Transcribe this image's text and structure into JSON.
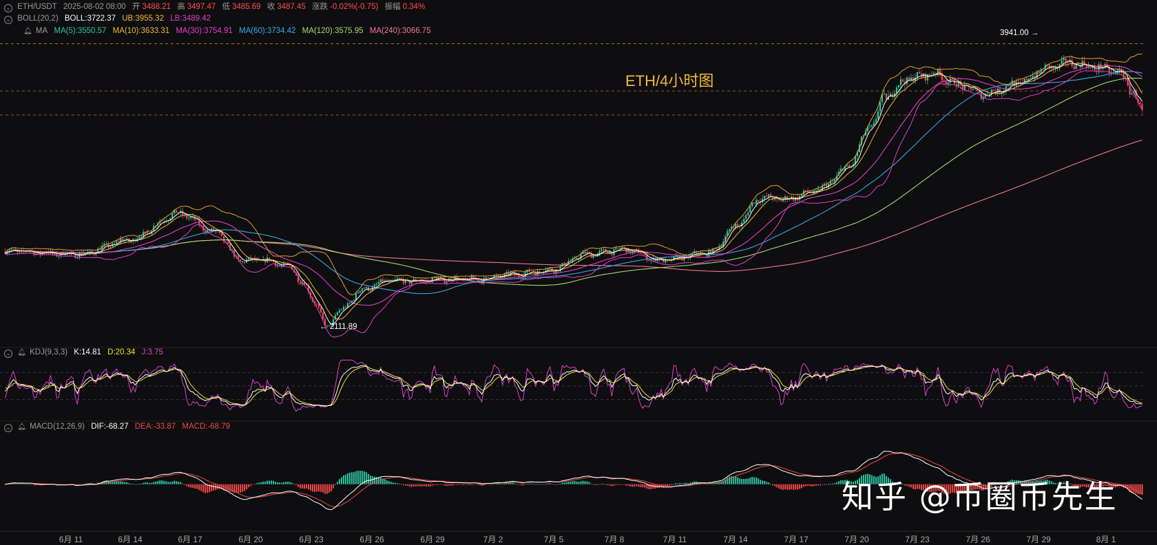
{
  "header": {
    "symbol": "ETH/USDT",
    "datetime": "2025-08-02 08:00",
    "open_label": "开",
    "open": "3488.21",
    "high_label": "高",
    "high": "3497.47",
    "low_label": "低",
    "low": "3485.69",
    "close_label": "收",
    "close": "3487.45",
    "change_label": "涨跌",
    "change": "-0.02%(-0.75)",
    "amp_label": "振幅",
    "amp": "0.34%"
  },
  "boll": {
    "name": "BOLL(20,2)",
    "mid": "BOLL:3722.37",
    "ub": "UB:3955.32",
    "lb": "LB:3489.42"
  },
  "ma": {
    "name": "MA",
    "ma5": "MA(5):3550.57",
    "ma10": "MA(10):3633.31",
    "ma30": "MA(30):3754.91",
    "ma60": "MA(60):3734.42",
    "ma120": "MA(120):3575.95",
    "ma240": "MA(240):3066.75"
  },
  "kdj": {
    "name": "KDJ(9,3,3)",
    "k": "K:14.81",
    "d": "D:20.34",
    "j": "J:3.75"
  },
  "macd": {
    "name": "MACD(12,26,9)",
    "dif": "DIF:-68.27",
    "dea": "DEA:-33.87",
    "macd": "MACD:-68.79"
  },
  "annotations": {
    "high_mark": "3941.00",
    "low_mark": "2111.89",
    "title": "ETH/4小时图"
  },
  "watermark": "知乎 @币圈币先生",
  "colors": {
    "up": "#2ec4a0",
    "down": "#f04848",
    "ma5": "#ffffff",
    "ma10": "#f3b73a",
    "ma30": "#e040c8",
    "ma60": "#38a8e8",
    "ma120": "#a8d870",
    "ma240": "#f07898",
    "boll": "#e8a030"
  },
  "chart_data": {
    "type": "candlestick",
    "timeframe": "4H",
    "x_ticks": [
      "6月 11",
      "6月 14",
      "6月 17",
      "6月 20",
      "6月 23",
      "6月 26",
      "6月 29",
      "7月 2",
      "7月 5",
      "7月 8",
      "7月 11",
      "7月 14",
      "7月 17",
      "7月 20",
      "7月 23",
      "7月 26",
      "7月 29",
      "8月 1"
    ],
    "price_path": [
      [
        0,
        2620
      ],
      [
        6,
        2600
      ],
      [
        10,
        2690
      ],
      [
        14,
        2860
      ],
      [
        17,
        2740
      ],
      [
        19,
        2560
      ],
      [
        21,
        2560
      ],
      [
        23,
        2520
      ],
      [
        24,
        2420
      ],
      [
        25,
        2300
      ],
      [
        26,
        2130
      ],
      [
        27,
        2240
      ],
      [
        29,
        2380
      ],
      [
        31,
        2430
      ],
      [
        33,
        2430
      ],
      [
        35,
        2440
      ],
      [
        38,
        2440
      ],
      [
        41,
        2470
      ],
      [
        44,
        2500
      ],
      [
        47,
        2600
      ],
      [
        50,
        2630
      ],
      [
        53,
        2560
      ],
      [
        57,
        2610
      ],
      [
        59,
        2780
      ],
      [
        61,
        2960
      ],
      [
        63,
        2950
      ],
      [
        65,
        2990
      ],
      [
        66,
        3020
      ],
      [
        68,
        3150
      ],
      [
        70,
        3420
      ],
      [
        71,
        3600
      ],
      [
        73,
        3720
      ],
      [
        75,
        3750
      ],
      [
        77,
        3680
      ],
      [
        79,
        3620
      ],
      [
        82,
        3690
      ],
      [
        84,
        3780
      ],
      [
        86,
        3820
      ],
      [
        88,
        3790
      ],
      [
        90,
        3760
      ],
      [
        91,
        3640
      ],
      [
        92,
        3490
      ]
    ],
    "x_span_days": 92,
    "ylim": [
      2050,
      4000
    ],
    "kdj_ylim": [
      -10,
      110
    ],
    "macd_ylim": [
      -180,
      200
    ]
  }
}
